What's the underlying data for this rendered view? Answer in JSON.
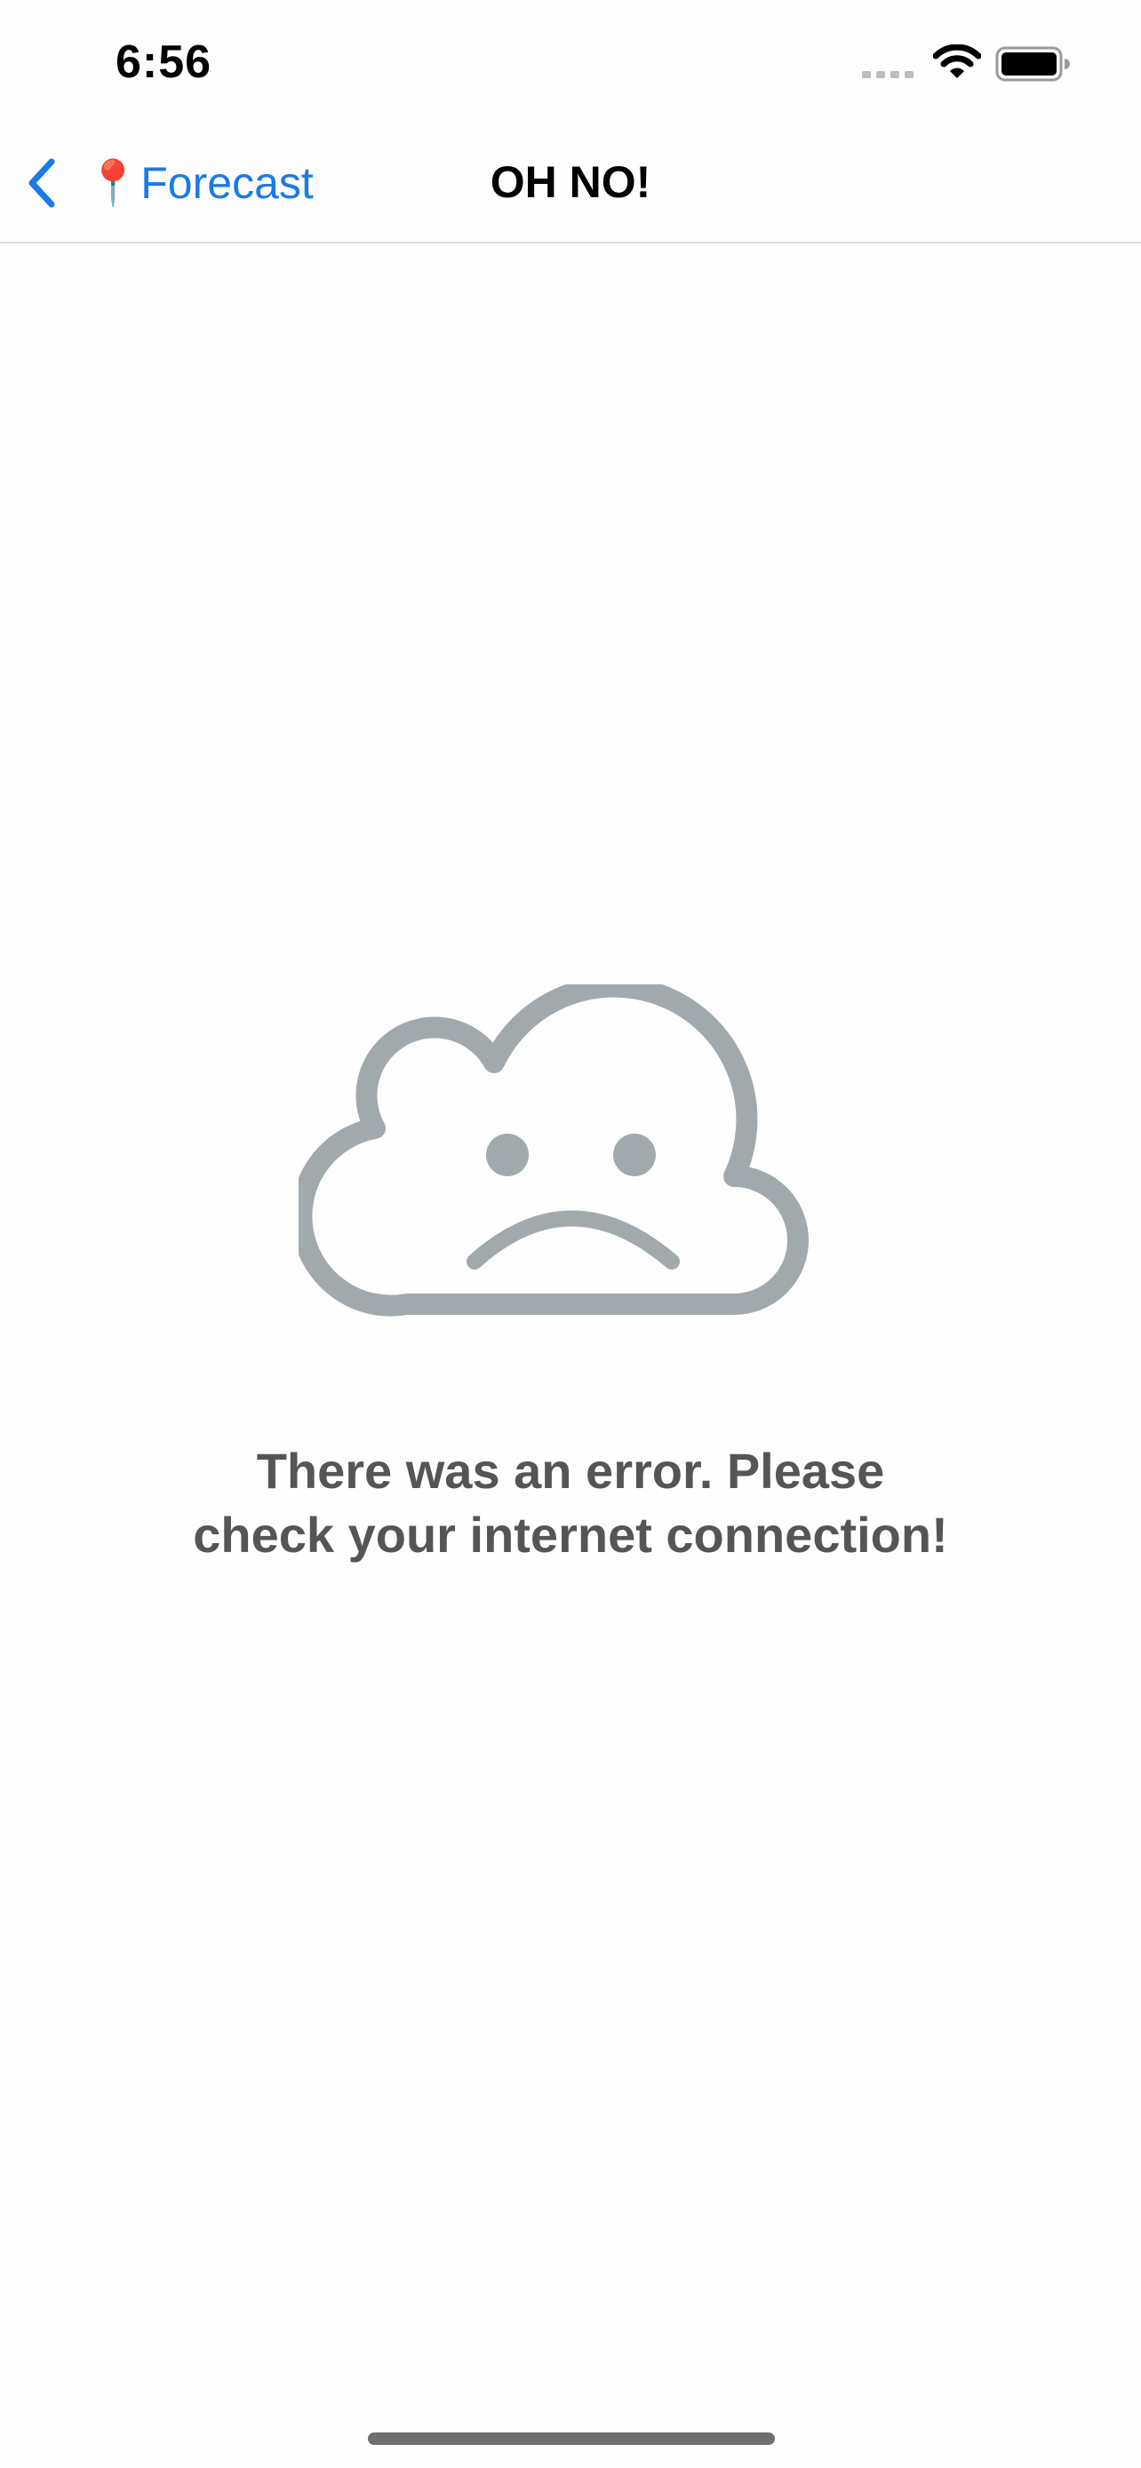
{
  "status_bar": {
    "time": "6:56",
    "icons": [
      "cellular-signal-icon",
      "wifi-icon",
      "battery-icon"
    ]
  },
  "nav": {
    "back_label": "📍Forecast",
    "title": "OH NO!",
    "back_icon": "chevron-left-icon"
  },
  "error": {
    "illustration": "sad-cloud-icon",
    "message_line1": "There was an error. Please",
    "message_line2": "check your internet connection!"
  },
  "colors": {
    "accent": "#1a7ae6",
    "illustration": "#a2a9ad",
    "message_text": "#555555",
    "background": "#fefefe"
  }
}
